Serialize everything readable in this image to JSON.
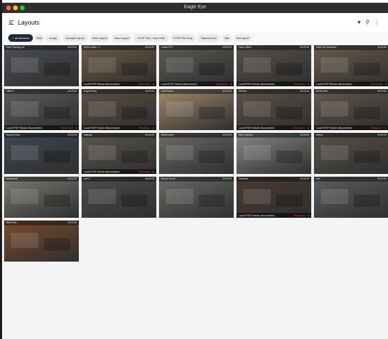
{
  "window": {
    "title": "Eagle Eye"
  },
  "header": {
    "title": "Layouts"
  },
  "chips": [
    {
      "label": "all cameras",
      "active": true
    },
    {
      "label": "DBD"
    },
    {
      "label": "empty"
    },
    {
      "label": "Example layout"
    },
    {
      "label": "New Layout"
    },
    {
      "label": "New Layout"
    },
    {
      "label": "RTSP Test - Don't Edit"
    },
    {
      "label": "RTSP Test 4mp"
    },
    {
      "label": "Stanford test"
    },
    {
      "label": "test"
    },
    {
      "label": "test layout"
    }
  ],
  "error_text": "Local RTSP Stream disconnected",
  "reconnect_label": "Reconnect",
  "cameras": [
    {
      "name": "Back Parking Lot",
      "time": "15:23:03",
      "error": false,
      "bg": "#4a4f54"
    },
    {
      "name": "ARIS Lobby - 2",
      "time": "15:23:03",
      "error": true,
      "bg": "#6b5a44"
    },
    {
      "name": "Lobby PTZ",
      "time": "15:23:03",
      "error": true,
      "bg": "#5b5a55"
    },
    {
      "name": "Open Office",
      "time": "15:23:03",
      "error": true,
      "bg": "#575048"
    },
    {
      "name": "Suite 400 Entrance",
      "time": "15:23:03",
      "error": true,
      "bg": "#6a5c4a"
    },
    {
      "name": "Office 2",
      "time": "15:23:03",
      "error": true,
      "bg": "#5a5c5a"
    },
    {
      "name": "Engineering",
      "time": "15:23:03",
      "error": true,
      "bg": "#5c5040"
    },
    {
      "name": "Conf Room",
      "time": "15:23:03",
      "error": false,
      "bg": "#a08a6c"
    },
    {
      "name": "Kitchen",
      "time": "15:23:03",
      "error": true,
      "bg": "#5e5246"
    },
    {
      "name": "Break Area",
      "time": "15:23:03",
      "error": true,
      "bg": "#64584c"
    },
    {
      "name": "Support Area",
      "time": "15:23:03",
      "error": false,
      "bg": "#3e4752"
    },
    {
      "name": "Hallway",
      "time": "15:23:03",
      "error": true,
      "bg": "#5c564e"
    },
    {
      "name": "Warehouse",
      "time": "15:23:03",
      "error": false,
      "bg": "#6e6c68"
    },
    {
      "name": "New Camera",
      "time": "15:23:03",
      "error": false,
      "bg": "#8a8886"
    },
    {
      "name": "Atrium",
      "time": "15:23:03",
      "error": false,
      "bg": "#5a5248"
    },
    {
      "name": "Mezzanine",
      "time": "15:23:03",
      "error": false,
      "bg": "#7e7a74"
    },
    {
      "name": "Lab 2",
      "time": "15:23:03",
      "error": false,
      "bg": "#4e4c48"
    },
    {
      "name": "Server Room",
      "time": "15:23:03",
      "error": false,
      "bg": "#6a6a66"
    },
    {
      "name": "Stairwell",
      "time": "15:23:03",
      "error": true,
      "bg": "#4a3a30"
    },
    {
      "name": "test",
      "time": "15:23:03",
      "error": false,
      "bg": "#5c5e62"
    },
    {
      "name": "Wall View",
      "time": "15:23:03",
      "error": false,
      "bg": "#7a4a2a"
    }
  ]
}
